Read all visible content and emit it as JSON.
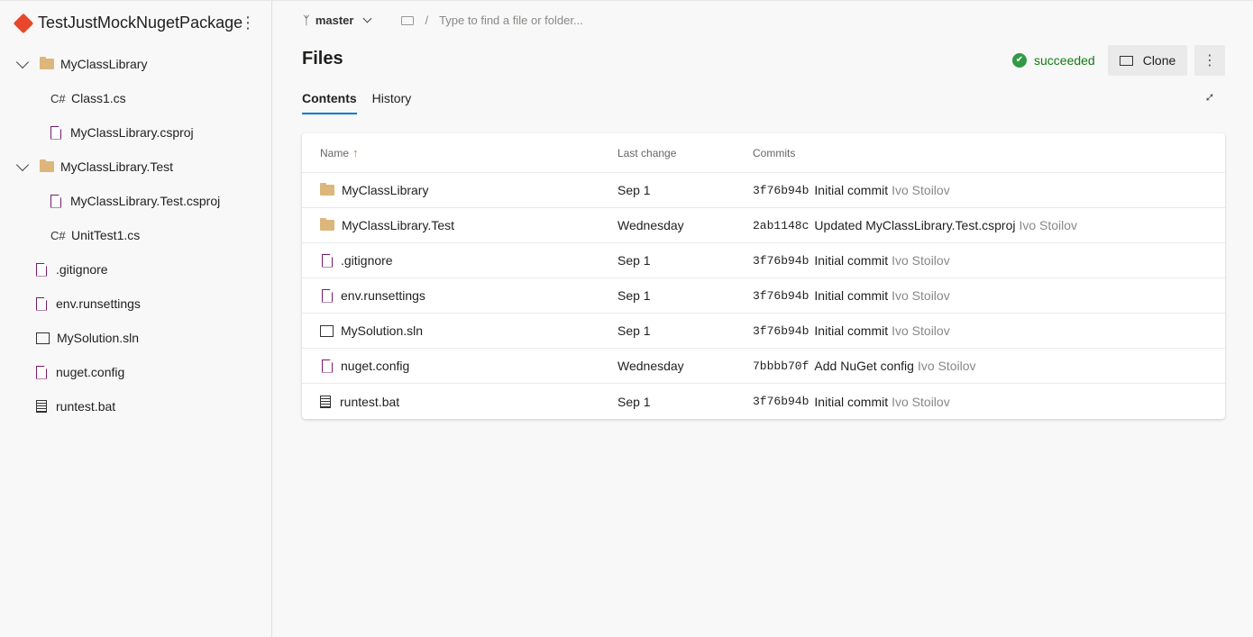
{
  "repo": {
    "name": "TestJustMockNugetPackage",
    "more_icon": "vertical-ellipsis"
  },
  "tree": [
    {
      "label": "MyClassLibrary",
      "type": "folder",
      "level": 0,
      "expanded": true
    },
    {
      "label": "Class1.cs",
      "type": "cs",
      "level": 1
    },
    {
      "label": "MyClassLibrary.csproj",
      "type": "file",
      "level": 1
    },
    {
      "label": "MyClassLibrary.Test",
      "type": "folder",
      "level": 0,
      "expanded": true
    },
    {
      "label": "MyClassLibrary.Test.csproj",
      "type": "file",
      "level": 1
    },
    {
      "label": "UnitTest1.cs",
      "type": "cs",
      "level": 1
    },
    {
      "label": ".gitignore",
      "type": "file",
      "level": 0
    },
    {
      "label": "env.runsettings",
      "type": "file",
      "level": 0
    },
    {
      "label": "MySolution.sln",
      "type": "sln",
      "level": 0
    },
    {
      "label": "nuget.config",
      "type": "file",
      "level": 0
    },
    {
      "label": "runtest.bat",
      "type": "bat",
      "level": 0
    }
  ],
  "cs_glyph": "C#",
  "top": {
    "branch": "master",
    "separator": "/",
    "search_placeholder": "Type to find a file or folder..."
  },
  "page_title": "Files",
  "status": "succeeded",
  "status_color": "#107c10",
  "clone_label": "Clone",
  "tabs": [
    {
      "label": "Contents",
      "active": true
    },
    {
      "label": "History",
      "active": false
    }
  ],
  "table": {
    "headers": {
      "name": "Name",
      "last_change": "Last change",
      "commits": "Commits"
    },
    "sort": "ascending",
    "rows": [
      {
        "name": "MyClassLibrary",
        "type": "folder",
        "last_change": "Sep 1",
        "hash": "3f76b94b",
        "message": "Initial commit",
        "author": "Ivo Stoilov"
      },
      {
        "name": "MyClassLibrary.Test",
        "type": "folder",
        "last_change": "Wednesday",
        "hash": "2ab1148c",
        "message": "Updated MyClassLibrary.Test.csproj",
        "author": "Ivo Stoilov"
      },
      {
        "name": ".gitignore",
        "type": "file",
        "last_change": "Sep 1",
        "hash": "3f76b94b",
        "message": "Initial commit",
        "author": "Ivo Stoilov"
      },
      {
        "name": "env.runsettings",
        "type": "file",
        "last_change": "Sep 1",
        "hash": "3f76b94b",
        "message": "Initial commit",
        "author": "Ivo Stoilov"
      },
      {
        "name": "MySolution.sln",
        "type": "sln",
        "last_change": "Sep 1",
        "hash": "3f76b94b",
        "message": "Initial commit",
        "author": "Ivo Stoilov"
      },
      {
        "name": "nuget.config",
        "type": "file",
        "last_change": "Wednesday",
        "hash": "7bbbb70f",
        "message": "Add NuGet config",
        "author": "Ivo Stoilov"
      },
      {
        "name": "runtest.bat",
        "type": "bat",
        "last_change": "Sep 1",
        "hash": "3f76b94b",
        "message": "Initial commit",
        "author": "Ivo Stoilov"
      }
    ]
  }
}
